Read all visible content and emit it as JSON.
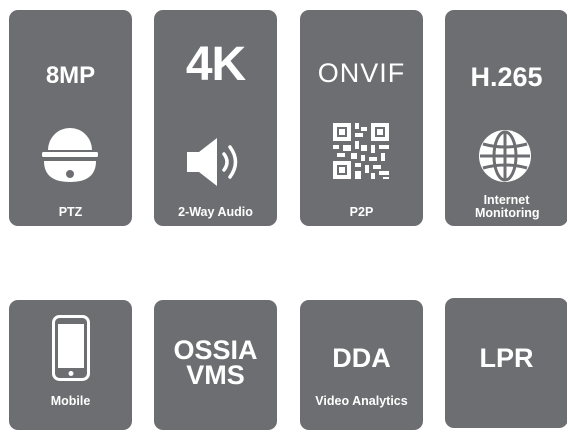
{
  "colors": {
    "tile": "#6d6e71",
    "text": "#ffffff"
  },
  "tiles": [
    {
      "top": "8MP",
      "bottom": "PTZ",
      "icon": "ptz-dome-camera-icon"
    },
    {
      "top": "4K",
      "bottom": "2-Way Audio",
      "icon": "speaker-icon"
    },
    {
      "top": "ONVIF",
      "bottom": "P2P",
      "icon": "qr-code-icon"
    },
    {
      "top": "H.265",
      "bottom": "Internet Monitoring",
      "icon": "globe-icon"
    },
    {
      "bottom": "Mobile",
      "icon": "smartphone-icon"
    },
    {
      "line1": "OSSIA",
      "line2": "VMS"
    },
    {
      "top": "DDA",
      "bottom": "Video Analytics"
    },
    {
      "top": "LPR"
    }
  ]
}
